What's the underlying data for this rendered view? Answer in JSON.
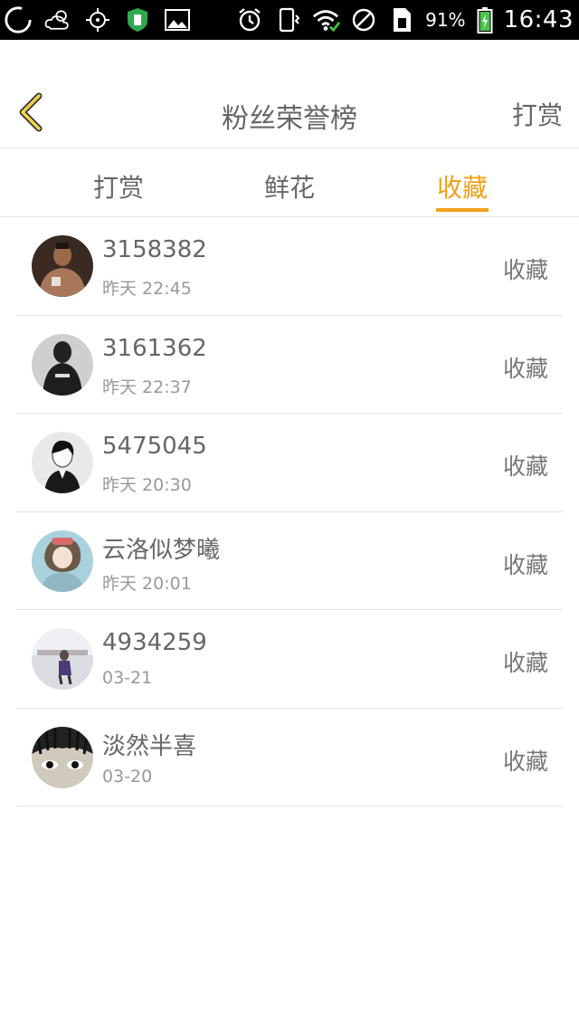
{
  "status_bar": {
    "battery_percent": "91%",
    "time": "16:43",
    "icons": [
      "loading-ring-icon",
      "weather-icon",
      "gps-icon",
      "shield-app-icon",
      "gallery-icon",
      "alarm-icon",
      "vibrate-icon",
      "wifi-icon",
      "no-disturb-icon",
      "sim-icon",
      "battery-charging-icon"
    ]
  },
  "header": {
    "title": "粉丝荣誉榜",
    "right_link": "打赏",
    "back_icon": "chevron-left-icon",
    "accent_color": "#f0a019"
  },
  "tabs": [
    {
      "label": "打赏",
      "active": false
    },
    {
      "label": "鲜花",
      "active": false
    },
    {
      "label": "收藏",
      "active": true
    }
  ],
  "list": [
    {
      "name": "3158382",
      "time": "昨天 22:45",
      "action": "收藏"
    },
    {
      "name": "3161362",
      "time": "昨天 22:37",
      "action": "收藏"
    },
    {
      "name": "5475045",
      "time": "昨天 20:30",
      "action": "收藏"
    },
    {
      "name": "云洛似梦曦",
      "time": "昨天 20:01",
      "action": "收藏"
    },
    {
      "name": "4934259",
      "time": "03-21",
      "action": "收藏"
    },
    {
      "name": "淡然半喜",
      "time": "03-20",
      "action": "收藏"
    }
  ]
}
